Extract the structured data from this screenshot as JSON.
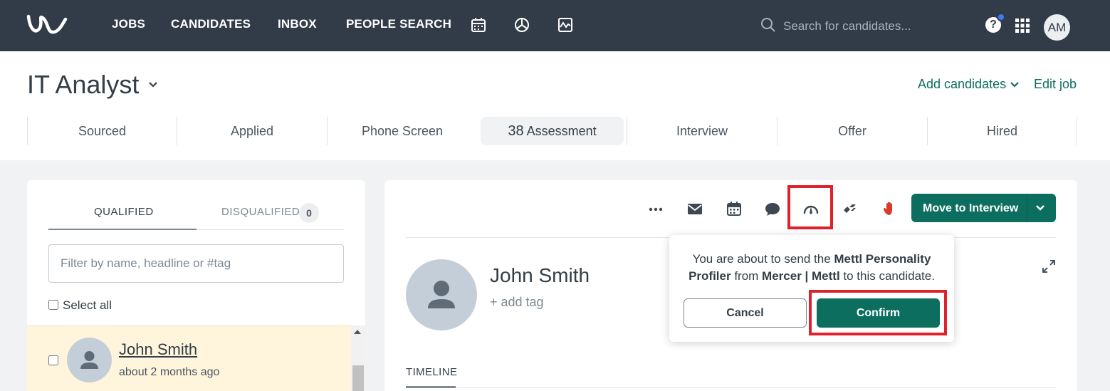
{
  "nav": {
    "logo_icon": "workable-w-logo-icon",
    "links": [
      "JOBS",
      "CANDIDATES",
      "INBOX",
      "PEOPLE SEARCH"
    ],
    "icons": [
      "calendar-icon",
      "pie-chart-icon",
      "reports-icon"
    ],
    "search_placeholder": "Search for candidates...",
    "help_label": "?",
    "user_initials": "AM"
  },
  "job": {
    "title": "IT Analyst",
    "add_candidates_label": "Add candidates",
    "edit_job_label": "Edit job",
    "stages": [
      {
        "label": "Sourced",
        "count": ""
      },
      {
        "label": "Applied",
        "count": ""
      },
      {
        "label": "Phone Screen",
        "count": ""
      },
      {
        "label": "Assessment",
        "count": "38",
        "active": true
      },
      {
        "label": "Interview",
        "count": ""
      },
      {
        "label": "Offer",
        "count": ""
      },
      {
        "label": "Hired",
        "count": ""
      }
    ]
  },
  "list": {
    "tab_qualified": "QUALIFIED",
    "tab_disqualified": "DISQUALIFIED",
    "disqualified_count": "0",
    "filter_placeholder": "Filter by name, headline or #tag",
    "select_all_label": "Select all",
    "candidates": [
      {
        "name": "John Smith",
        "time": "about 2 months ago"
      }
    ]
  },
  "profile": {
    "actions": [
      "more-icon",
      "email-icon",
      "calendar-icon",
      "comment-icon",
      "assessment-gauge-icon",
      "video-interview-icon",
      "disqualify-hand-icon"
    ],
    "move_button_label": "Move to Interview",
    "candidate_name": "John Smith",
    "add_tag_label": "+ add tag",
    "timeline_tab": "TIMELINE"
  },
  "popover": {
    "text_1": "You are about to send the ",
    "assessment_name": "Mettl Personality Profiler",
    "text_2": " from ",
    "provider": "Mercer | Mettl",
    "text_3": " to this candidate.",
    "cancel_label": "Cancel",
    "confirm_label": "Confirm"
  },
  "colors": {
    "nav_bg": "#313c48",
    "brand_green": "#0c6e5f",
    "highlight_red": "#e0202a",
    "selected_row": "#fff5dc",
    "disqualify_red": "#d93a2b"
  }
}
